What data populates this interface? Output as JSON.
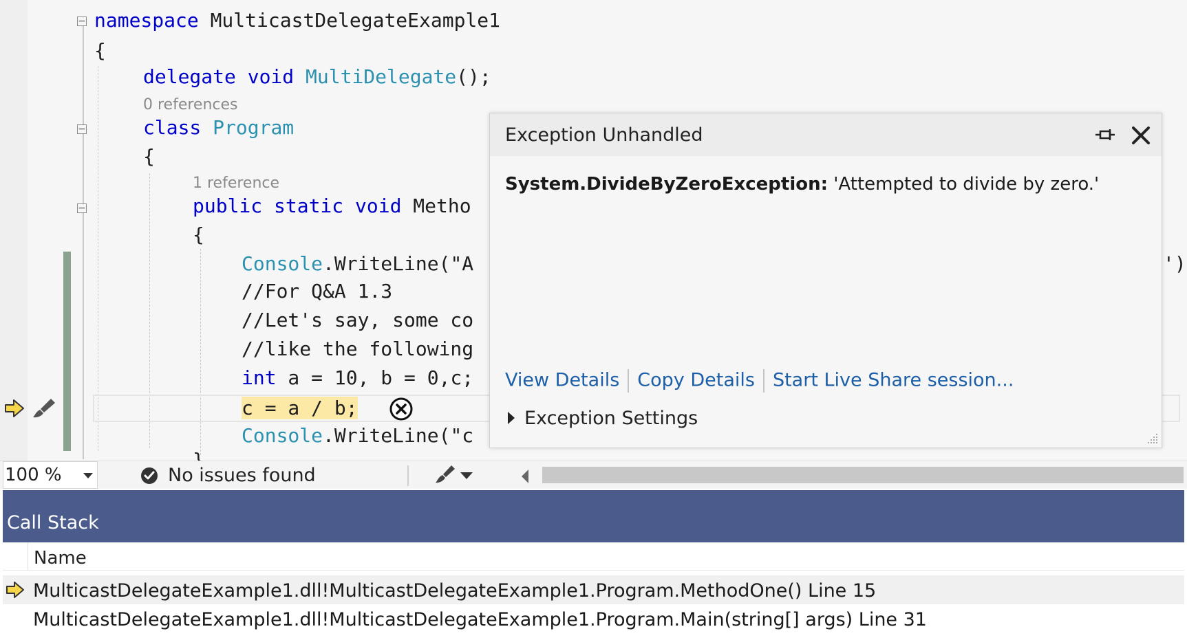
{
  "editor": {
    "code": {
      "l1": {
        "kw": "namespace",
        "rest": " MulticastDelegateExample1"
      },
      "l2": "{",
      "l3": {
        "kw": "delegate void",
        "ty": " MultiDelegate",
        "rest": "();"
      },
      "lens1": "0 references",
      "l4": {
        "kw": "class",
        "ty": " Program"
      },
      "l5": "{",
      "lens2": "1 reference",
      "l6": {
        "kw": "public static void",
        "rest": " Metho"
      },
      "l7": "{",
      "l8": {
        "ty": "Console",
        "rest": ".WriteLine(\"A"
      },
      "l8_tail": "');",
      "l9": "//For Q&A 1.3",
      "l10": "//Let's say, some co",
      "l11": "//like the following",
      "l12": {
        "kw": "int",
        "rest": " a = 10, b = 0,c;"
      },
      "l13": "c = a / b;",
      "l14": {
        "ty": "Console",
        "rest": ".WriteLine(\"c"
      },
      "l15": "}"
    }
  },
  "popup": {
    "title": "Exception Unhandled",
    "exception_type": "System.DivideByZeroException:",
    "exception_message": " 'Attempted to divide by zero.'",
    "links": {
      "view_details": "View Details",
      "copy_details": "Copy Details",
      "live_share": "Start Live Share session..."
    },
    "exception_settings": "Exception Settings"
  },
  "status": {
    "zoom": "100 %",
    "issues": "No issues found"
  },
  "call_stack": {
    "title": "Call Stack",
    "column_name": "Name",
    "rows": [
      "MulticastDelegateExample1.dll!MulticastDelegateExample1.Program.MethodOne() Line 15",
      "MulticastDelegateExample1.dll!MulticastDelegateExample1.Program.Main(string[] args) Line 31"
    ]
  },
  "colors": {
    "keyword": "#0000c8",
    "type": "#2b91af",
    "call_stack_header": "#4a5b8c",
    "highlight": "#fbe9a5",
    "link": "#1c5fa8"
  }
}
